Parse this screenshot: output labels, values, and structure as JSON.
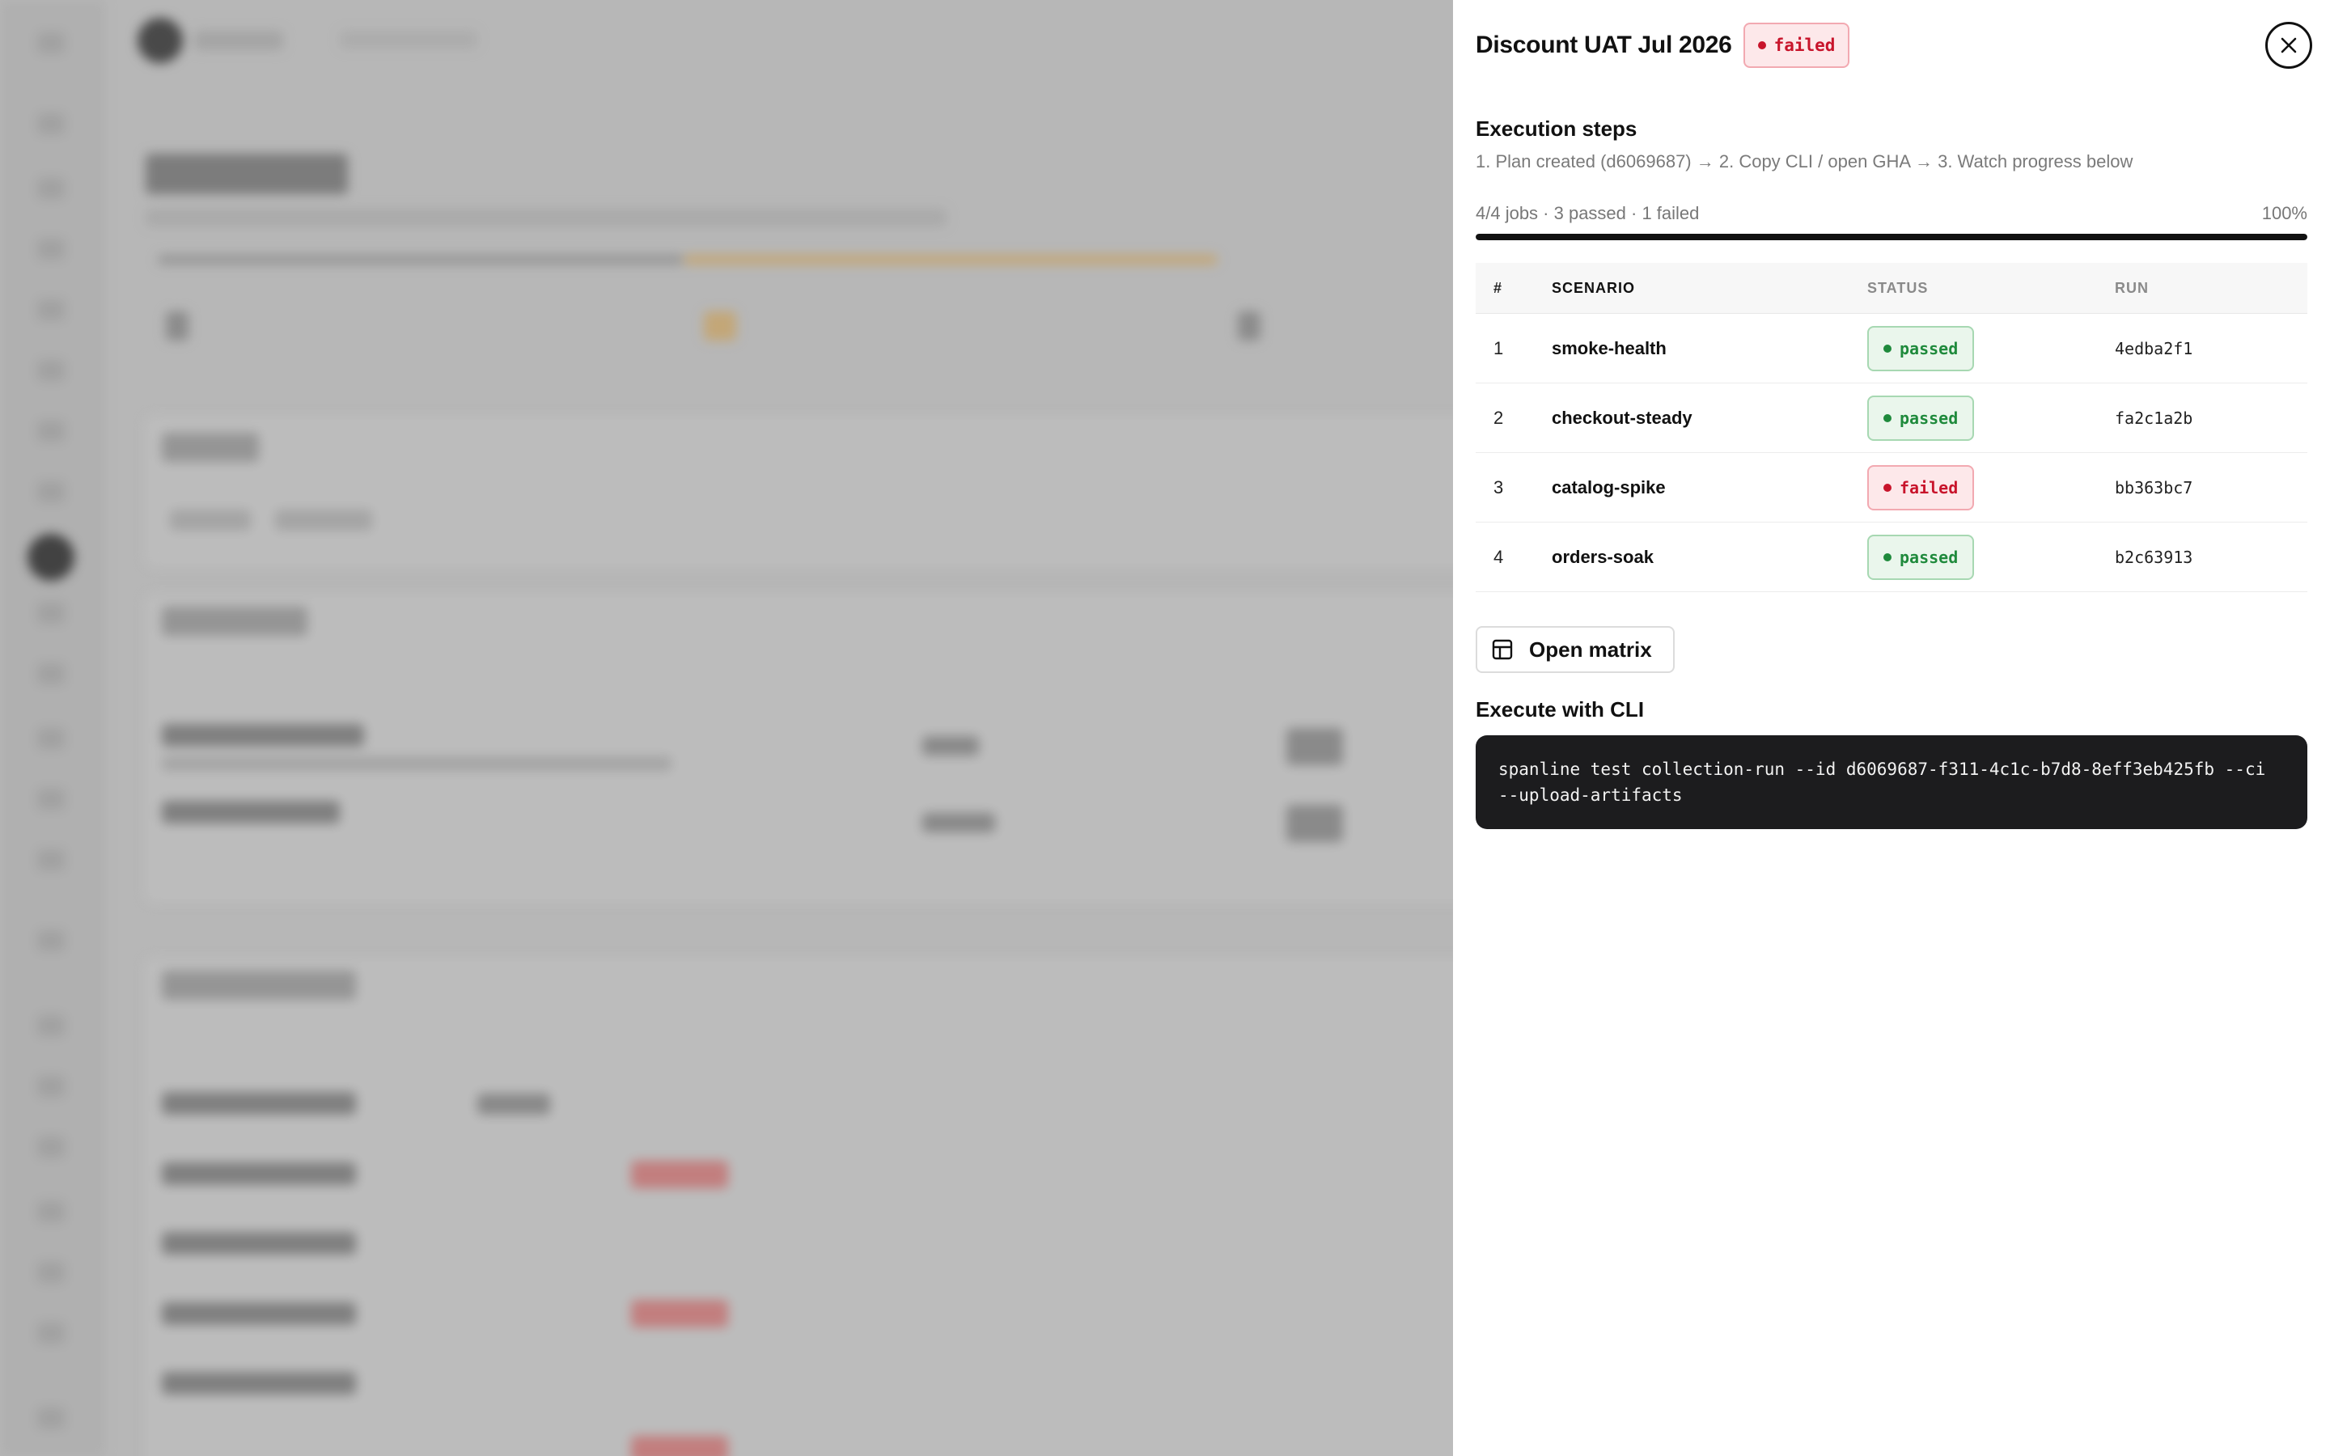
{
  "drawer": {
    "title": "Discount UAT Jul 2026",
    "status": "failed",
    "close_icon": "close-icon",
    "execution": {
      "heading": "Execution steps",
      "steps": "1. Plan created (d6069687) → 2. Copy CLI / open GHA → 3. Watch progress below"
    },
    "progress": {
      "summary": "4/4 jobs · 3 passed · 1 failed",
      "percent_label": "100%",
      "fraction": 1.0
    },
    "table": {
      "headers": [
        "#",
        "SCENARIO",
        "STATUS",
        "RUN"
      ],
      "rows": [
        {
          "num": "1",
          "scenario": "smoke-health",
          "status": "passed",
          "run": "4edba2f1"
        },
        {
          "num": "2",
          "scenario": "checkout-steady",
          "status": "passed",
          "run": "fa2c1a2b"
        },
        {
          "num": "3",
          "scenario": "catalog-spike",
          "status": "failed",
          "run": "bb363bc7"
        },
        {
          "num": "4",
          "scenario": "orders-soak",
          "status": "passed",
          "run": "b2c63913"
        }
      ]
    },
    "matrix_button": {
      "label": "Open matrix",
      "icon": "table-grid-icon"
    },
    "cli": {
      "heading": "Execute with CLI",
      "command": "spanline test collection-run --id d6069687-f311-4c1c-b7d8-8eff3eb425fb --ci --upload-artifacts"
    },
    "colors": {
      "failed": "#c8142b",
      "passed": "#1f8a3c",
      "code_bg": "#1c1c1e"
    }
  }
}
